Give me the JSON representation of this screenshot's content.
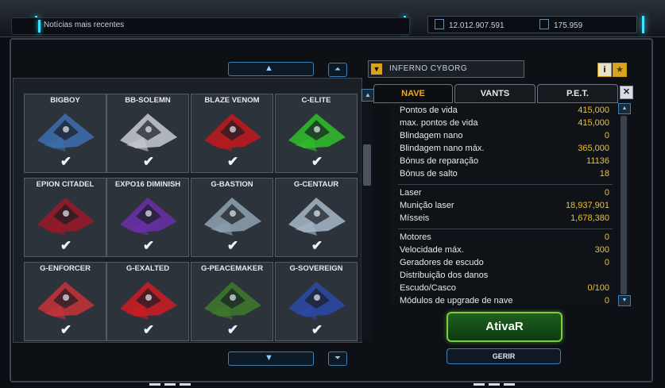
{
  "header": {
    "news_label": "Notícias mais recentes",
    "credits": "12.012.907.591",
    "uridium": "175.959"
  },
  "ship_list": {
    "ships": [
      {
        "name": "BIGBOY",
        "color": "#3e6fb0"
      },
      {
        "name": "BB-SOLEMN",
        "color": "#c8ccd2"
      },
      {
        "name": "BLAZE VENOM",
        "color": "#c2181f"
      },
      {
        "name": "C-ELITE",
        "color": "#2fbf2a"
      },
      {
        "name": "EPION CITADEL",
        "color": "#9a1828"
      },
      {
        "name": "EXPO16 DIMINISH",
        "color": "#6a2fa8"
      },
      {
        "name": "G-BASTION",
        "color": "#8fa2b3"
      },
      {
        "name": "G-CENTAUR",
        "color": "#a8b8c8"
      },
      {
        "name": "G-ENFORCER",
        "color": "#c8323a"
      },
      {
        "name": "G-EXALTED",
        "color": "#d01c24"
      },
      {
        "name": "G-PEACEMAKER",
        "color": "#3e7a2c"
      },
      {
        "name": "G-SOVEREIGN",
        "color": "#2c4aa8"
      }
    ],
    "check_glyph": "✔",
    "scroll_up": "▲",
    "scroll_down": "▼",
    "page_up": "⏶",
    "page_down": "⏷"
  },
  "detail": {
    "dropdown_value": "INFERNO CYBORG",
    "tabs": [
      "NAVE",
      "VANTS",
      "P.E.T."
    ],
    "active_tab": "NAVE",
    "stats_group1": [
      {
        "k": "Pontos de vida",
        "v": "415,000"
      },
      {
        "k": "max. pontos de vida",
        "v": "415,000"
      },
      {
        "k": "Blindagem nano",
        "v": "0"
      },
      {
        "k": "Blindagem nano máx.",
        "v": "365,000"
      },
      {
        "k": "Bónus de reparação",
        "v": "11136"
      },
      {
        "k": "Bónus de salto",
        "v": "18"
      }
    ],
    "stats_group2": [
      {
        "k": "Laser",
        "v": "0"
      },
      {
        "k": "Munição laser",
        "v": "18,937,901"
      },
      {
        "k": "Mísseis",
        "v": "1,678,380"
      }
    ],
    "stats_group3": [
      {
        "k": "Motores",
        "v": "0"
      },
      {
        "k": "Velocidade máx.",
        "v": "300"
      },
      {
        "k": "Geradores de escudo",
        "v": "0"
      },
      {
        "k": "Distribuição dos danos",
        "v": ""
      },
      {
        "k": "Escudo/Casco",
        "v": "0/100"
      },
      {
        "k": "Módulos de upgrade de nave",
        "v": "0"
      }
    ],
    "activate_label": "AtivaR",
    "manage_label": "GERIR"
  }
}
